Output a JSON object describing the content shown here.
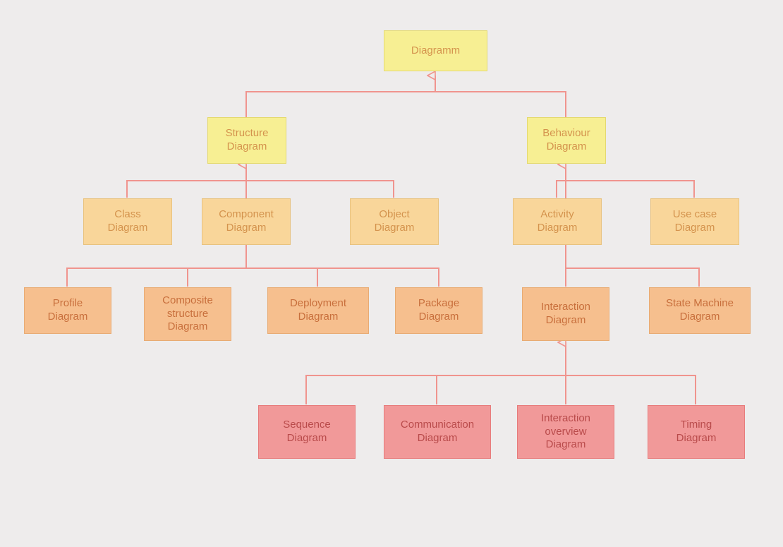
{
  "nodes": {
    "root": "Diagramm",
    "structure": "Structure\nDiagram",
    "behaviour": "Behaviour\nDiagram",
    "class": "Class\nDiagram",
    "component": "Component\nDiagram",
    "object": "Object\nDiagram",
    "activity": "Activity\nDiagram",
    "usecase": "Use case\nDiagram",
    "profile": "Profile\nDiagram",
    "composite": "Composite\nstructure\nDiagram",
    "deployment": "Deployment\nDiagram",
    "package": "Package\nDiagram",
    "interaction": "Interaction\nDiagram",
    "statemachine": "State Machine\nDiagram",
    "sequence": "Sequence\nDiagram",
    "communication": "Communication\nDiagram",
    "interactionover": "Interaction\noverview\nDiagram",
    "timing": "Timing\nDiagram"
  }
}
